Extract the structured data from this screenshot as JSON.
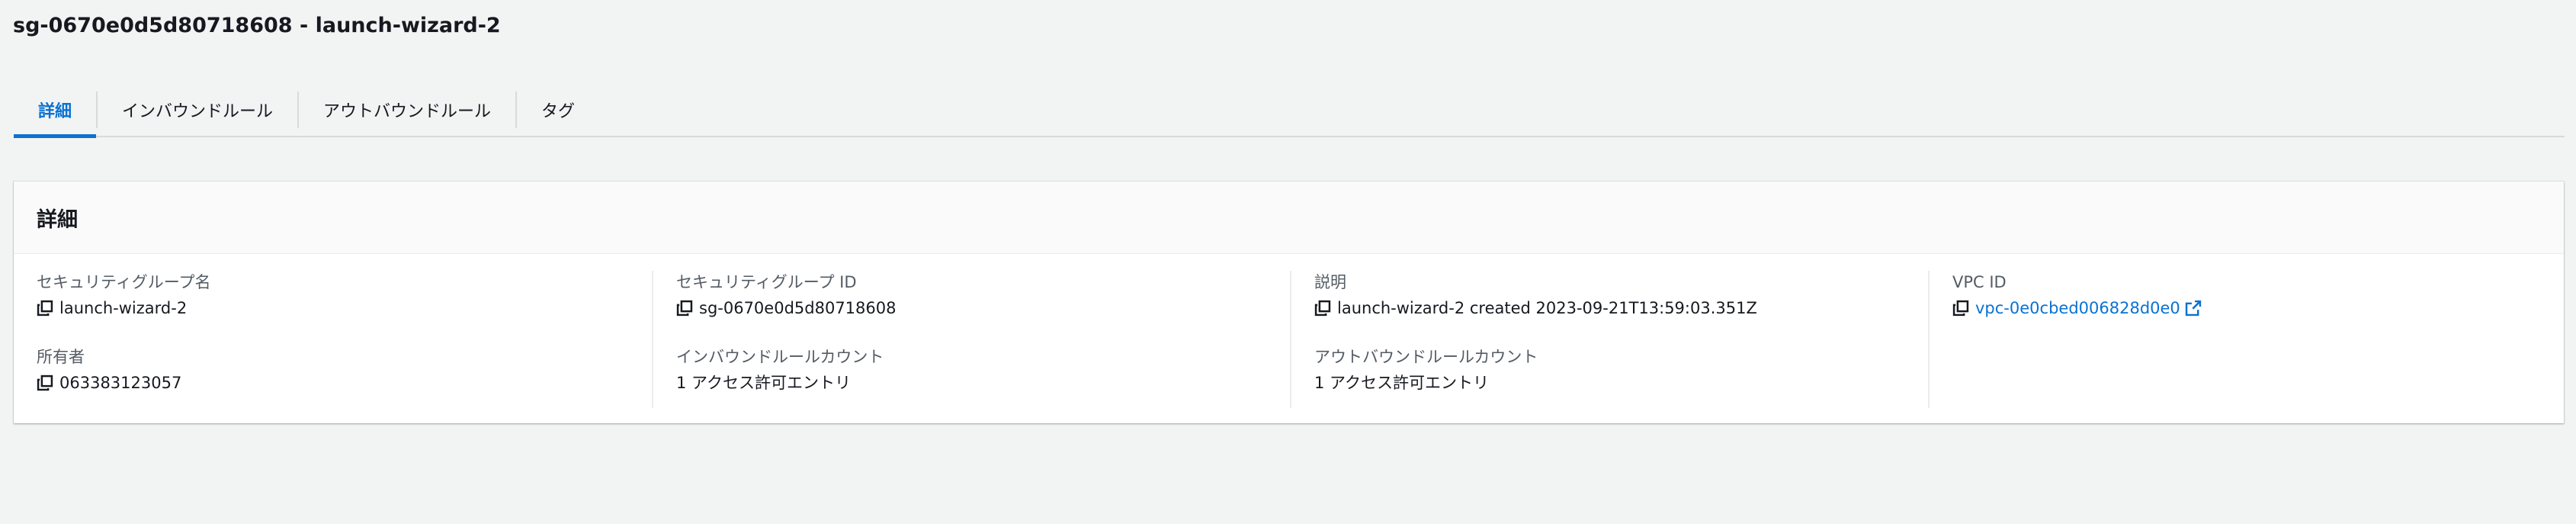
{
  "page": {
    "title": "sg-0670e0d5d80718608 - launch-wizard-2"
  },
  "tabs": [
    {
      "label": "詳細",
      "active": true
    },
    {
      "label": "インバウンドルール",
      "active": false
    },
    {
      "label": "アウトバウンドルール",
      "active": false
    },
    {
      "label": "タグ",
      "active": false
    }
  ],
  "details": {
    "header": "詳細",
    "security_group_name": {
      "label": "セキュリティグループ名",
      "value": "launch-wizard-2"
    },
    "security_group_id": {
      "label": "セキュリティグループ ID",
      "value": "sg-0670e0d5d80718608"
    },
    "description": {
      "label": "説明",
      "value": "launch-wizard-2 created 2023-09-21T13:59:03.351Z"
    },
    "vpc_id": {
      "label": "VPC ID",
      "value": "vpc-0e0cbed006828d0e0"
    },
    "owner": {
      "label": "所有者",
      "value": "063383123057"
    },
    "inbound_rule_count": {
      "label": "インバウンドルールカウント",
      "value": "1 アクセス許可エントリ"
    },
    "outbound_rule_count": {
      "label": "アウトバウンドルールカウント",
      "value": "1 アクセス許可エントリ"
    }
  },
  "colors": {
    "accent": "#0972d3",
    "background": "#f2f3f3",
    "label": "#545b64"
  },
  "icons": {
    "copy": "copy-icon",
    "external": "external-link-icon"
  }
}
